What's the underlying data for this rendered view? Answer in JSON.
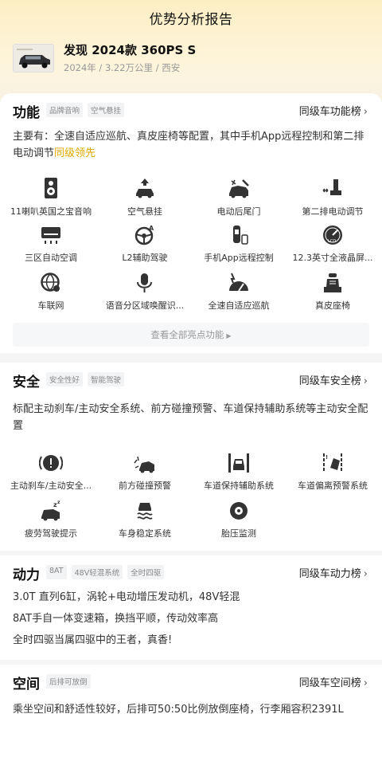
{
  "header": {
    "title": "优势分析报告"
  },
  "car": {
    "name": "发现 2024款 360PS S",
    "meta": "2024年 / 3.22万公里 / 西安"
  },
  "function": {
    "title": "功能",
    "tags": [
      "品牌音响",
      "空气悬挂"
    ],
    "rank_link": "同级车功能榜",
    "desc_main": "主要有：全速自适应巡航、真皮座椅等配置，其中手机App远程控制和第二排电动调节",
    "desc_highlight": "同级领先",
    "features": [
      {
        "label": "11喇叭英国之宝音响",
        "icon": "speaker-icon"
      },
      {
        "label": "空气悬挂",
        "icon": "air-suspension-icon"
      },
      {
        "label": "电动后尾门",
        "icon": "power-tailgate-icon"
      },
      {
        "label": "第二排电动调节",
        "icon": "seat-adjust-icon"
      },
      {
        "label": "三区自动空调",
        "icon": "air-conditioner-icon"
      },
      {
        "label": "L2辅助驾驶",
        "icon": "steering-wheel-icon"
      },
      {
        "label": "手机App远程控制",
        "icon": "phone-remote-icon"
      },
      {
        "label": "12.3英寸全液晶屏...",
        "icon": "lcd-gauge-icon"
      },
      {
        "label": "车联网",
        "icon": "globe-icon"
      },
      {
        "label": "语音分区域唤醒识...",
        "icon": "microphone-icon"
      },
      {
        "label": "全速自适应巡航",
        "icon": "cruise-control-icon"
      },
      {
        "label": "真皮座椅",
        "icon": "leather-seat-icon"
      }
    ],
    "see_all": "查看全部亮点功能"
  },
  "safety": {
    "title": "安全",
    "tags": [
      "安全性好",
      "智能驾驶"
    ],
    "rank_link": "同级车安全榜",
    "desc": "标配主动刹车/主动安全系统、前方碰撞预警、车道保持辅助系统等主动安全配置",
    "features": [
      {
        "label": "主动刹车/主动安全...",
        "icon": "brake-warning-icon"
      },
      {
        "label": "前方碰撞预警",
        "icon": "collision-warning-icon"
      },
      {
        "label": "车道保持辅助系统",
        "icon": "lane-keep-icon"
      },
      {
        "label": "车道偏离预警系统",
        "icon": "lane-departure-icon"
      },
      {
        "label": "疲劳驾驶提示",
        "icon": "fatigue-icon"
      },
      {
        "label": "车身稳定系统",
        "icon": "stability-icon"
      },
      {
        "label": "胎压监测",
        "icon": "tire-pressure-icon"
      }
    ]
  },
  "power": {
    "title": "动力",
    "tags": [
      "8AT",
      "48V轻混系统",
      "全时四驱"
    ],
    "rank_link": "同级车动力榜",
    "lines": [
      "3.0T 直列6缸，涡轮+电动增压发动机，48V轻混",
      "8AT手自一体变速箱，换挡平顺，传动效率高",
      "全时四驱当属四驱中的王者，真香!"
    ]
  },
  "space": {
    "title": "空间",
    "tags": [
      "后排可放倒"
    ],
    "rank_link": "同级车空间榜",
    "desc": "乘坐空间和舒适性较好，后排可50:50比例放倒座椅，行李厢容积2391L"
  },
  "colors": {
    "accent": "#e0a800",
    "icon": "#333333"
  }
}
